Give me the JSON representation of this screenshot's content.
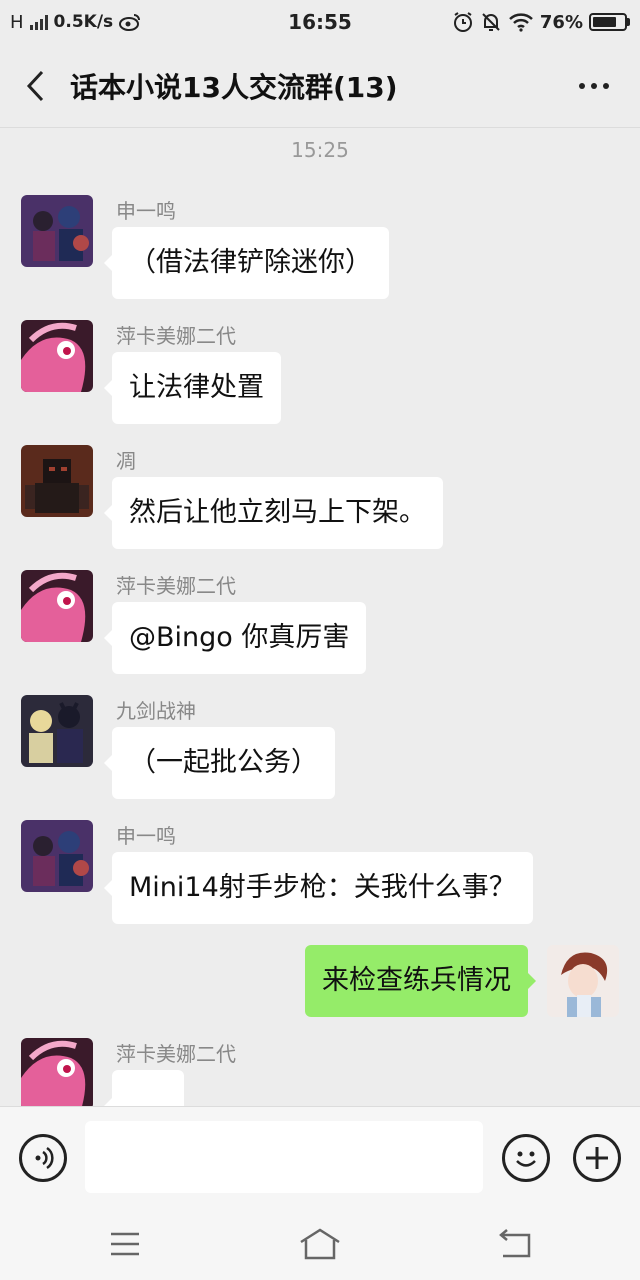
{
  "status_bar": {
    "network": "H",
    "speed": "0.5K/s",
    "time": "16:55",
    "battery": "76%",
    "battery_level": 0.76
  },
  "header": {
    "title": "话本小说13人交流群(13)"
  },
  "chat": {
    "timestamp": "15:25",
    "messages": [
      {
        "sender": "申一鸣",
        "text": "（借法律铲除迷你）",
        "direction": "in",
        "avatar": "group-anime-avatar"
      },
      {
        "sender": "萍卡美娜二代",
        "text": "让法律处置",
        "direction": "in",
        "avatar": "pink-pony-avatar"
      },
      {
        "sender": "凋",
        "text": "然后让他立刻马上下架。",
        "direction": "in",
        "avatar": "dark-robot-avatar"
      },
      {
        "sender": "萍卡美娜二代",
        "text": "@Bingo  你真厉害",
        "direction": "in",
        "avatar": "pink-pony-avatar"
      },
      {
        "sender": "九剑战神",
        "text": "（一起批公务）",
        "direction": "in",
        "avatar": "duo-anime-avatar"
      },
      {
        "sender": "申一鸣",
        "text": "Mini14射手步枪：关我什么事？",
        "direction": "in",
        "avatar": "group-anime-avatar"
      },
      {
        "sender": "",
        "text": "来检查练兵情况",
        "direction": "out",
        "avatar": "self-anime-avatar"
      },
      {
        "sender": "萍卡美娜二代",
        "text": "",
        "direction": "in",
        "avatar": "pink-pony-avatar"
      }
    ]
  },
  "input": {
    "placeholder": ""
  },
  "colors": {
    "background": "#ededed",
    "incoming_bubble": "#ffffff",
    "outgoing_bubble": "#95ec69",
    "sender_text": "#888888"
  }
}
